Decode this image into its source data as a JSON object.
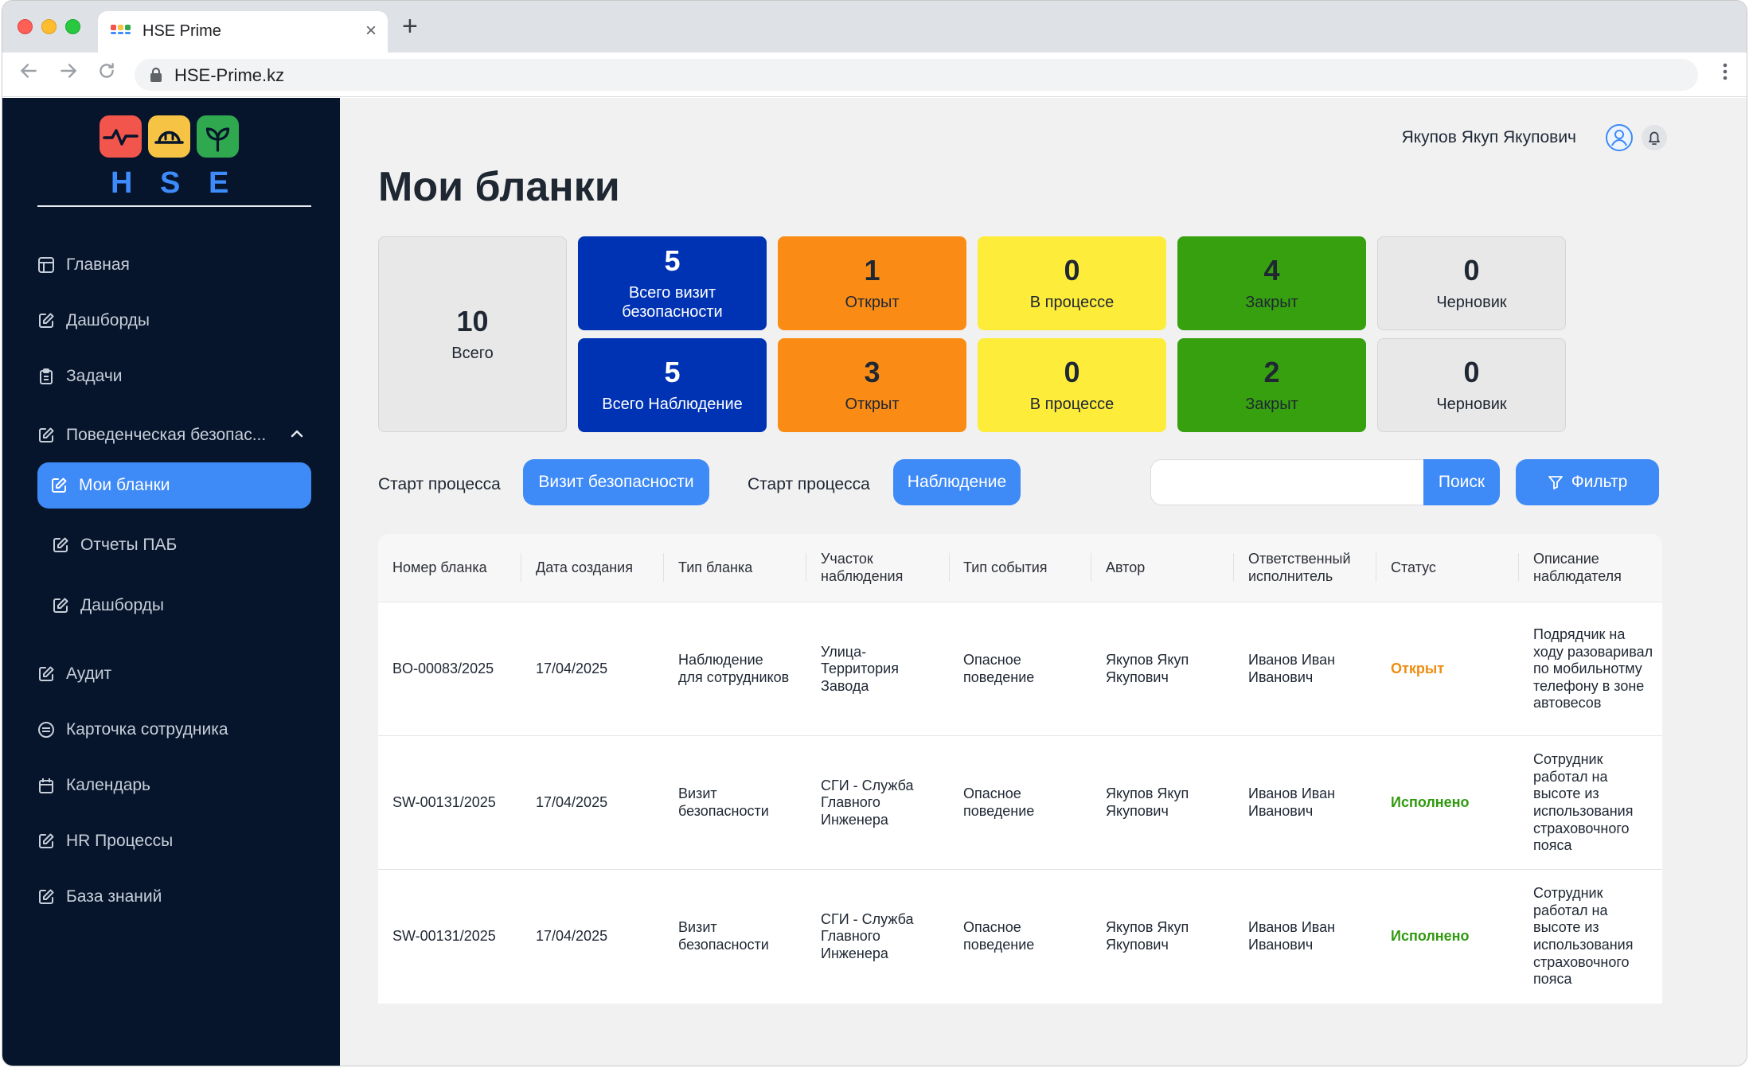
{
  "browser": {
    "tab_title": "HSE Prime",
    "tab_close": "×",
    "new_tab": "+",
    "url": "HSE-Prime.kz"
  },
  "logo": {
    "letters": [
      "H",
      "S",
      "E"
    ]
  },
  "sidebar": {
    "items": [
      {
        "label": "Главная",
        "icon": "layout-icon"
      },
      {
        "label": "Дашборды",
        "icon": "edit-icon"
      },
      {
        "label": "Задачи",
        "icon": "clipboard-icon"
      },
      {
        "label": "Поведенческая безопас...",
        "icon": "edit-icon",
        "expanded": true
      },
      {
        "label": "Мои бланки",
        "icon": "edit-icon",
        "active": true
      },
      {
        "label": "Отчеты ПАБ",
        "icon": "edit-icon"
      },
      {
        "label": "Дашборды",
        "icon": "edit-icon"
      },
      {
        "label": "Аудит",
        "icon": "edit-icon"
      },
      {
        "label": "Карточка сотрудника",
        "icon": "badge-icon"
      },
      {
        "label": "Календарь",
        "icon": "calendar-icon"
      },
      {
        "label": "HR Процессы",
        "icon": "edit-icon"
      },
      {
        "label": "База знаний",
        "icon": "edit-icon"
      }
    ]
  },
  "header": {
    "user_name": "Якупов Якуп Якупович",
    "page_title": "Мои бланки"
  },
  "stats": {
    "total": {
      "value": "10",
      "label": "Всего"
    },
    "row1": [
      {
        "value": "5",
        "label": "Всего визит безопасности"
      },
      {
        "value": "1",
        "label": "Открыт"
      },
      {
        "value": "0",
        "label": "В процессе"
      },
      {
        "value": "4",
        "label": "Закрыт"
      },
      {
        "value": "0",
        "label": "Черновик"
      }
    ],
    "row2": [
      {
        "value": "5",
        "label": "Всего Наблюдение"
      },
      {
        "value": "3",
        "label": "Открыт"
      },
      {
        "value": "0",
        "label": "В процессе"
      },
      {
        "value": "2",
        "label": "Закрыт"
      },
      {
        "value": "0",
        "label": "Черновик"
      }
    ]
  },
  "actions": {
    "start_label_1": "Старт процесса",
    "start_btn_1": "Визит безопасности",
    "start_label_2": "Старт процесса",
    "start_btn_2": "Наблюдение",
    "search_value": "",
    "search_btn": "Поиск",
    "filter_btn": "Фильтр"
  },
  "table": {
    "columns": [
      "Номер бланка",
      "Дата создания",
      "Тип бланка",
      "Участок наблюдения",
      "Тип события",
      "Автор",
      "Ответственный исполнитель",
      "Статус",
      "Описание наблюдателя"
    ],
    "rows": [
      [
        "BO-00083/2025",
        "17/04/2025",
        "Наблюдение для сотрудников",
        "Улица-Территория Завода",
        "Опасное поведение",
        "Якупов Якуп Якупович",
        "Иванов Иван Иванович",
        "Открыт",
        "Подрядчик на ходу разоваривал по мобильнотму телефону в зоне автовесов"
      ],
      [
        "SW-00131/2025",
        "17/04/2025",
        "Визит безопасности",
        "СГИ - Служба Главного Инженера",
        "Опасное поведение",
        "Якупов Якуп Якупович",
        "Иванов Иван Иванович",
        "Исполнено",
        "Сотрудник работал на высоте из использования страховочного пояса"
      ],
      [
        "SW-00131/2025",
        "17/04/2025",
        "Визит безопасности",
        "СГИ - Служба Главного Инженера",
        "Опасное поведение",
        "Якупов Якуп Якупович",
        "Иванов Иван Иванович",
        "Исполнено",
        "Сотрудник работал на высоте из использования страховочного пояса"
      ]
    ]
  },
  "colors": {
    "sidebar_bg": "#06152b",
    "accent": "#3e8af7",
    "tile_blue": "#0033b3",
    "tile_orange": "#fa8c16",
    "tile_yellow": "#feec3b",
    "tile_green": "#37a00f",
    "status_open": "#f08c10",
    "status_done": "#2f9a0e"
  }
}
